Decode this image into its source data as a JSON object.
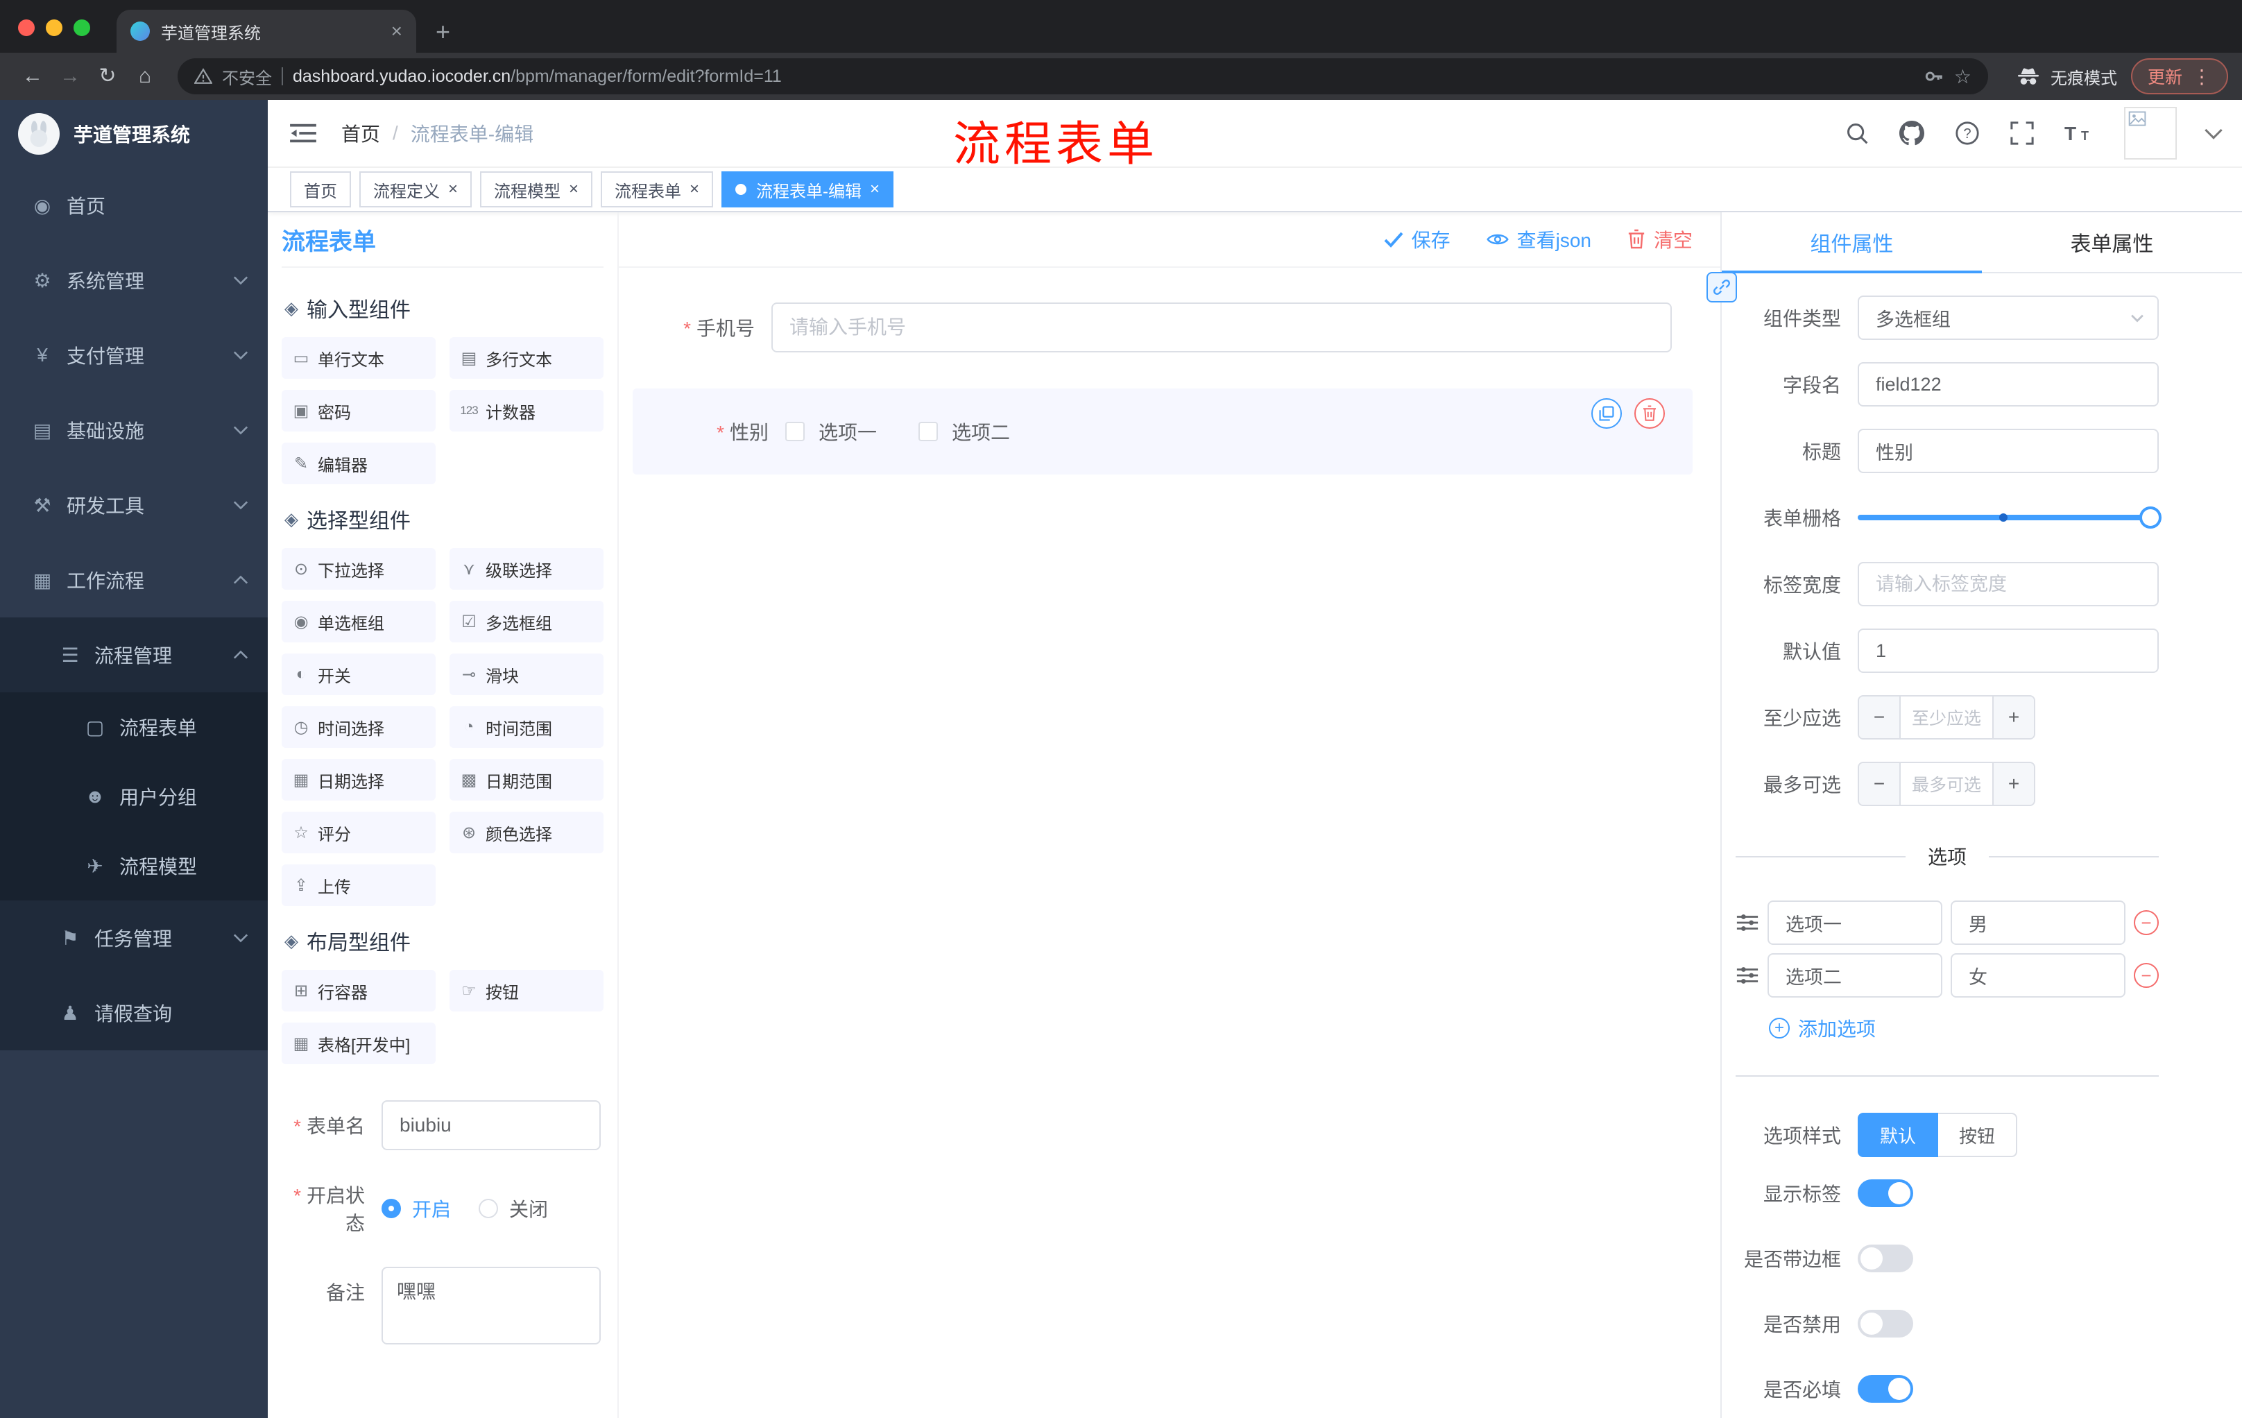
{
  "ui": {
    "close": "×",
    "minus": "−",
    "plus": "+",
    "breadcrumb_sep": "/"
  },
  "browser": {
    "tab_title": "芋道管理系统",
    "new_tab": "+",
    "nav": {
      "back": "←",
      "forward": "→",
      "reload": "↻",
      "home": "⌂"
    },
    "security_label": "不安全",
    "url_domain": "dashboard.yudao.iocoder.cn",
    "url_path": "/bpm/manager/form/edit?formId=11",
    "bookmark_star": "☆",
    "incognito_label": "无痕模式",
    "update_label": "更新",
    "menu_dots": "⋮"
  },
  "annotation": {
    "text": "流程表单"
  },
  "sidebar": {
    "logo_title": "芋道管理系统",
    "items": [
      {
        "label": "首页",
        "icon": "◉"
      },
      {
        "label": "系统管理",
        "icon": "⚙"
      },
      {
        "label": "支付管理",
        "icon": "¥"
      },
      {
        "label": "基础设施",
        "icon": "▤"
      },
      {
        "label": "研发工具",
        "icon": "⚒"
      },
      {
        "label": "工作流程",
        "icon": "▦"
      },
      {
        "label": "流程管理",
        "icon": "☰"
      },
      {
        "label": "流程表单",
        "icon": "▢"
      },
      {
        "label": "用户分组",
        "icon": "☻"
      },
      {
        "label": "流程模型",
        "icon": "✈"
      },
      {
        "label": "任务管理",
        "icon": "⚑"
      },
      {
        "label": "请假查询",
        "icon": "♟"
      }
    ]
  },
  "header": {
    "breadcrumb_home": "首页",
    "breadcrumb_current": "流程表单-编辑"
  },
  "tags": [
    {
      "label": "首页"
    },
    {
      "label": "流程定义"
    },
    {
      "label": "流程模型"
    },
    {
      "label": "流程表单"
    },
    {
      "label": "流程表单-编辑"
    }
  ],
  "designer": {
    "title": "流程表单",
    "save": "保存",
    "view_json": "查看json",
    "clear": "清空",
    "groups": [
      {
        "title": "输入型组件",
        "items": [
          {
            "label": "单行文本",
            "icon": "▭"
          },
          {
            "label": "多行文本",
            "icon": "▤"
          },
          {
            "label": "密码",
            "icon": "▣"
          },
          {
            "label": "计数器",
            "icon": "123"
          },
          {
            "label": "编辑器",
            "icon": "✎"
          }
        ]
      },
      {
        "title": "选择型组件",
        "items": [
          {
            "label": "下拉选择",
            "icon": "⊙"
          },
          {
            "label": "级联选择",
            "icon": "⋎"
          },
          {
            "label": "单选框组",
            "icon": "◉"
          },
          {
            "label": "多选框组",
            "icon": "☑"
          },
          {
            "label": "开关",
            "icon": "◐"
          },
          {
            "label": "滑块",
            "icon": "⊸"
          },
          {
            "label": "时间选择",
            "icon": "◷"
          },
          {
            "label": "时间范围",
            "icon": "◔"
          },
          {
            "label": "日期选择",
            "icon": "▦"
          },
          {
            "label": "日期范围",
            "icon": "▩"
          },
          {
            "label": "评分",
            "icon": "☆"
          },
          {
            "label": "颜色选择",
            "icon": "⊛"
          },
          {
            "label": "上传",
            "icon": "⇪"
          }
        ]
      },
      {
        "title": "布局型组件",
        "items": [
          {
            "label": "行容器",
            "icon": "⊞"
          },
          {
            "label": "按钮",
            "icon": "☞"
          },
          {
            "label": "表格[开发中]",
            "icon": "▦"
          }
        ]
      }
    ],
    "meta": {
      "name_label": "表单名",
      "name_value": "biubiu",
      "status_label": "开启状态",
      "status_on": "开启",
      "status_off": "关闭",
      "remark_label": "备注",
      "remark_value": "嘿嘿"
    },
    "canvas": {
      "phone_label": "手机号",
      "phone_placeholder": "请输入手机号",
      "gender_label": "性别",
      "gender_opt1": "选项一",
      "gender_opt2": "选项二"
    }
  },
  "props": {
    "tab_component": "组件属性",
    "tab_form": "表单属性",
    "component_type_label": "组件类型",
    "component_type_value": "多选框组",
    "field_label": "字段名",
    "field_value": "field122",
    "title_label": "标题",
    "title_value": "性别",
    "grid_label": "表单栅格",
    "label_width_label": "标签宽度",
    "label_width_placeholder": "请输入标签宽度",
    "default_label": "默认值",
    "default_value": "1",
    "min_label": "至少应选",
    "min_placeholder": "至少应选",
    "max_label": "最多可选",
    "max_placeholder": "最多可选",
    "options_divider": "选项",
    "options": [
      {
        "label": "选项一",
        "value": "男"
      },
      {
        "label": "选项二",
        "value": "女"
      }
    ],
    "add_option": "添加选项",
    "style_label": "选项样式",
    "style_default": "默认",
    "style_button": "按钮",
    "toggle_show_label": "显示标签",
    "toggle_border": "是否带边框",
    "toggle_disabled": "是否禁用",
    "toggle_required": "是否必填"
  }
}
